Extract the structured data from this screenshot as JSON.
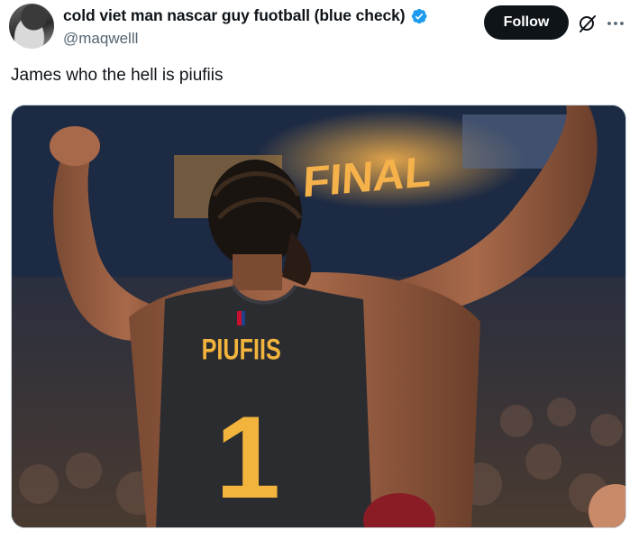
{
  "author": {
    "display_name": "cold viet man nascar guy fuotball (blue check)",
    "handle": "@maqwelll",
    "verified_color": "#1d9bf0"
  },
  "actions": {
    "follow_label": "Follow",
    "grok_icon": "grok-icon",
    "more_icon": "more-icon"
  },
  "tweet": {
    "text": "James who the hell is piufiis"
  },
  "media": {
    "scoreboard_text": "FINAL",
    "jersey_name": "PIUFIIS",
    "jersey_number": "1",
    "jersey_text_color": "#f2b43c"
  }
}
